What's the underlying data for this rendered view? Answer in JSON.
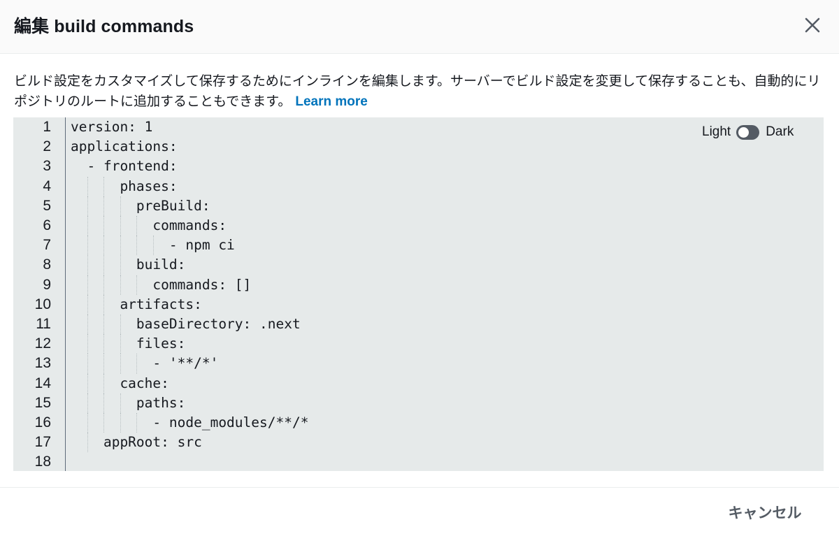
{
  "modal": {
    "title": "編集 build commands",
    "description": "ビルド設定をカスタマイズして保存するためにインラインを編集します。サーバーでビルド設定を変更して保存することも、自動的にリポジトリのルートに追加することもできます。",
    "learn_more": "Learn more",
    "cancel_label": "キャンセル",
    "close_icon": "close-icon"
  },
  "editor": {
    "theme": {
      "light_label": "Light",
      "dark_label": "Dark",
      "dark_enabled": false
    },
    "lines": [
      "version: 1",
      "applications:",
      "  - frontend:",
      "      phases:",
      "        preBuild:",
      "          commands:",
      "            - npm ci",
      "        build:",
      "          commands: []",
      "      artifacts:",
      "        baseDirectory: .next",
      "        files:",
      "          - '**/*'",
      "      cache:",
      "        paths:",
      "          - node_modules/**/*",
      "    appRoot: src",
      ""
    ]
  },
  "colors": {
    "link": "#0073bb",
    "editor_bg": "#e6eaea",
    "toggle": "#545b64"
  }
}
